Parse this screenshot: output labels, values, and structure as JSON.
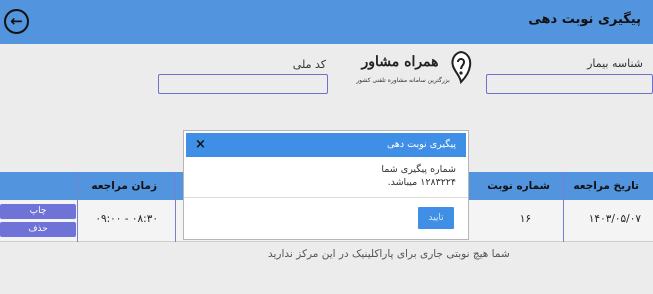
{
  "header": {
    "title": "پیگیری نوبت دهی"
  },
  "form": {
    "patient_id_label": "شناسه بیمار",
    "national_code_label": "کد ملی"
  },
  "logo": {
    "name": "همراه مشاور",
    "tagline": "بزرگترین سامانه مشاوره تلفنی کشور"
  },
  "table": {
    "headers": {
      "date": "تاریخ مراجعه",
      "turn_number": "شماره نوبت",
      "visit_time": "زمان مراجعه"
    },
    "row": {
      "date": "۱۴۰۳/۰۵/۰۷",
      "turn_number": "۱۶",
      "visit_time": "۰۸:۳۰ - ۰۹:۰۰"
    },
    "print_button": "چاپ",
    "delete_button": "حذف"
  },
  "no_visit_message": "شما هیچ نوبتی جاری برای پاراکلینیک در این مرکز ندارید",
  "modal": {
    "title": "پیگیری نوبت دهی",
    "close": "×",
    "line1": "شماره پیگیری شما",
    "line2": "۱۲۸۳۲۲۴ میباشد.",
    "ok_button": "تایید"
  }
}
